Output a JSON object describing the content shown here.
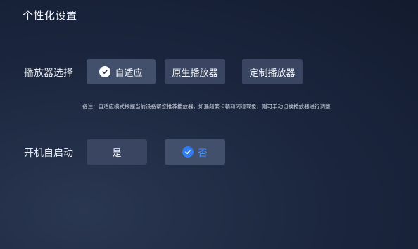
{
  "page": {
    "title": "个性化设置"
  },
  "player": {
    "label": "播放器选择",
    "options": [
      {
        "label": "自适应",
        "selected": true
      },
      {
        "label": "原生播放器",
        "selected": false
      },
      {
        "label": "定制播放器",
        "selected": false
      }
    ],
    "note": "备注：自适应模式根据当前设备帮您推荐播放器，如遇频繁卡顿和闪退现象，则可手动切换播放器进行调整"
  },
  "autostart": {
    "label": "开机自启动",
    "options": [
      {
        "label": "是",
        "selected": false
      },
      {
        "label": "否",
        "selected": true
      }
    ]
  },
  "colors": {
    "accent": "#2f7df0",
    "option_bg": "#3a4661",
    "bg_dark": "#121a2d"
  },
  "icons": {
    "selected": "check-circle-icon"
  }
}
